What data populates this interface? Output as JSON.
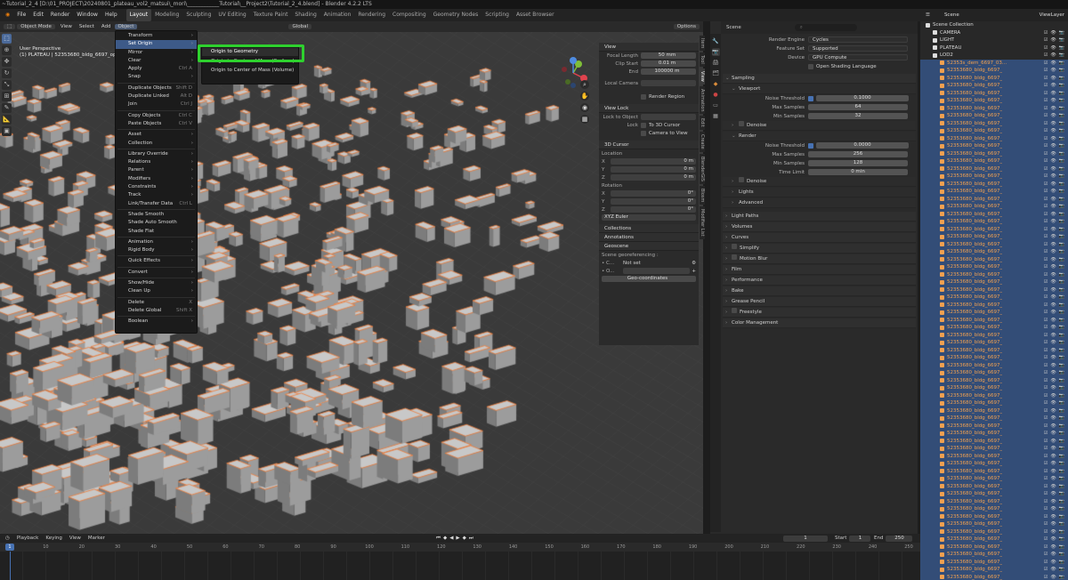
{
  "titlebar": {
    "text": "~Tutorial_2_4 [D:\\01_PROJECT\\20240801_plateau_vol2_matsui\\_mori\\____________Tutorial\\__Project2\\Tutorial_2_4.blend] - Blender 4.2.2 LTS"
  },
  "menubar": {
    "items": [
      "File",
      "Edit",
      "Render",
      "Window",
      "Help"
    ],
    "workspaces": [
      "Layout",
      "Modeling",
      "Sculpting",
      "UV Editing",
      "Texture Paint",
      "Shading",
      "Animation",
      "Rendering",
      "Compositing",
      "Geometry Nodes",
      "Scripting",
      "Asset Browser"
    ],
    "scene_label": "Scene",
    "viewlayer_label": "ViewLayer"
  },
  "viewport": {
    "mode": "Object Mode",
    "menus": [
      "View",
      "Select",
      "Add",
      "Object"
    ],
    "transform": "Global",
    "options": "Options",
    "info_line1": "User Perspective",
    "info_line2": "(1) PLATEAU | 52353680_bldg_6697_op..."
  },
  "object_menu": {
    "items": [
      {
        "label": "Transform",
        "shortcut": "",
        "arrow": true
      },
      {
        "label": "Set Origin",
        "shortcut": "",
        "arrow": true,
        "highlight": true
      },
      {
        "label": "Mirror",
        "shortcut": "",
        "arrow": true
      },
      {
        "label": "Clear",
        "shortcut": "",
        "arrow": true
      },
      {
        "label": "Apply",
        "shortcut": "Ctrl A",
        "arrow": false
      },
      {
        "label": "Snap",
        "shortcut": "",
        "arrow": true
      },
      {
        "sep": true
      },
      {
        "label": "Duplicate Objects",
        "shortcut": "Shift D",
        "arrow": false
      },
      {
        "label": "Duplicate Linked",
        "shortcut": "Alt D",
        "arrow": false
      },
      {
        "label": "Join",
        "shortcut": "Ctrl J",
        "arrow": false
      },
      {
        "sep": true
      },
      {
        "label": "Copy Objects",
        "shortcut": "Ctrl C",
        "arrow": false
      },
      {
        "label": "Paste Objects",
        "shortcut": "Ctrl V",
        "arrow": false
      },
      {
        "sep": true
      },
      {
        "label": "Asset",
        "shortcut": "",
        "arrow": true
      },
      {
        "label": "Collection",
        "shortcut": "",
        "arrow": true
      },
      {
        "sep": true
      },
      {
        "label": "Library Override",
        "shortcut": "",
        "arrow": true
      },
      {
        "label": "Relations",
        "shortcut": "",
        "arrow": true
      },
      {
        "label": "Parent",
        "shortcut": "",
        "arrow": true
      },
      {
        "label": "Modifiers",
        "shortcut": "",
        "arrow": true
      },
      {
        "label": "Constraints",
        "shortcut": "",
        "arrow": true
      },
      {
        "label": "Track",
        "shortcut": "",
        "arrow": true
      },
      {
        "label": "Link/Transfer Data",
        "shortcut": "Ctrl L",
        "arrow": false
      },
      {
        "sep": true
      },
      {
        "label": "Shade Smooth",
        "shortcut": "",
        "arrow": false
      },
      {
        "label": "Shade Auto Smooth",
        "shortcut": "",
        "arrow": false
      },
      {
        "label": "Shade Flat",
        "shortcut": "",
        "arrow": false
      },
      {
        "sep": true
      },
      {
        "label": "Animation",
        "shortcut": "",
        "arrow": true
      },
      {
        "label": "Rigid Body",
        "shortcut": "",
        "arrow": true
      },
      {
        "sep": true
      },
      {
        "label": "Quick Effects",
        "shortcut": "",
        "arrow": true
      },
      {
        "sep": true
      },
      {
        "label": "Convert",
        "shortcut": "",
        "arrow": true
      },
      {
        "sep": true
      },
      {
        "label": "Show/Hide",
        "shortcut": "",
        "arrow": true
      },
      {
        "label": "Clean Up",
        "shortcut": "",
        "arrow": true
      },
      {
        "sep": true
      },
      {
        "label": "Delete",
        "shortcut": "X",
        "arrow": false
      },
      {
        "label": "Delete Global",
        "shortcut": "Shift X",
        "arrow": false
      },
      {
        "sep": true
      },
      {
        "label": "Boolean",
        "shortcut": "",
        "arrow": true
      }
    ]
  },
  "set_origin_menu": {
    "items": [
      "Origin to Geometry",
      "Origin to Center of Mass (Surface)",
      "Origin to Center of Mass (Volume)"
    ],
    "highlighted": "Origin to Geometry"
  },
  "npanel": {
    "view_header": "View",
    "focal_length": {
      "label": "Focal Length",
      "value": "50 mm"
    },
    "clip_start": {
      "label": "Clip Start",
      "value": "0.01 m"
    },
    "clip_end": {
      "label": "End",
      "value": "100000 m"
    },
    "local_camera": "Local Camera",
    "render_region": "Render Region",
    "view_lock_header": "View Lock",
    "lock_to_object": "Lock to Object",
    "lock": "Lock",
    "to_3d_cursor": "To 3D Cursor",
    "camera_to_view": "Camera to View",
    "cursor_header": "3D Cursor",
    "location_label": "Location",
    "rotation_label": "Rotation",
    "loc": [
      {
        "axis": "X",
        "value": "0 m"
      },
      {
        "axis": "Y",
        "value": "0 m"
      },
      {
        "axis": "Z",
        "value": "0 m"
      }
    ],
    "rot": [
      {
        "axis": "X",
        "value": "0°"
      },
      {
        "axis": "Y",
        "value": "0°"
      },
      {
        "axis": "Z",
        "value": "0°"
      }
    ],
    "rotation_mode": "XYZ Euler",
    "collections": "Collections",
    "annotations": "Annotations",
    "geoscene": "Geoscene",
    "geo_label": "Scene georeferencing :",
    "not_set": "Not set",
    "geo_coords": "Geo-coordinates",
    "tabs": [
      "Item",
      "Tool",
      "View",
      "Animation",
      "Edit",
      "Create",
      "BlenderGIS",
      "Blosm",
      "Modifier List"
    ]
  },
  "properties": {
    "scene_label": "Scene",
    "search_placeholder": "",
    "render_engine": {
      "label": "Render Engine",
      "value": "Cycles"
    },
    "feature_set": {
      "label": "Feature Set",
      "value": "Supported"
    },
    "device": {
      "label": "Device",
      "value": "GPU Compute"
    },
    "osl": "Open Shading Language",
    "sampling": "Sampling",
    "viewport": "Viewport",
    "vp_noise": {
      "label": "Noise Threshold",
      "value": "0.1000"
    },
    "vp_max": {
      "label": "Max Samples",
      "value": "64"
    },
    "vp_min": {
      "label": "Min Samples",
      "value": "32"
    },
    "denoise": "Denoise",
    "render": "Render",
    "r_noise": {
      "label": "Noise Threshold",
      "value": "0.0000"
    },
    "r_max": {
      "label": "Max Samples",
      "value": "256"
    },
    "r_min": {
      "label": "Min Samples",
      "value": "128"
    },
    "r_time": {
      "label": "Time Limit",
      "value": "0 min"
    },
    "r_denoise": "Denoise",
    "lights": "Lights",
    "advanced": "Advanced",
    "sections": [
      "Light Paths",
      "Volumes",
      "Curves",
      "Simplify",
      "Motion Blur",
      "Film",
      "Performance",
      "Bake",
      "Grease Pencil",
      "Freestyle",
      "Color Management"
    ]
  },
  "outliner": {
    "scene_collection": "Scene Collection",
    "items": [
      {
        "name": "CAMERA",
        "indent": 1,
        "sel": false,
        "color": "#e06b3a"
      },
      {
        "name": "LIGHT",
        "indent": 1,
        "sel": false,
        "color": "#e06b3a"
      },
      {
        "name": "PLATEAU",
        "indent": 1,
        "sel": false,
        "color": "#e06b3a"
      },
      {
        "name": "LOD2",
        "indent": 1,
        "sel": false,
        "color": "#e06b3a"
      }
    ],
    "prefix": "52353680_bldg_6697_",
    "first": "52353s_dem_6697_03..."
  },
  "timeline": {
    "menus": [
      "Playback",
      "Keying",
      "View",
      "Marker"
    ],
    "current": "1",
    "start_label": "Start",
    "start": "1",
    "end_label": "End",
    "end": "250",
    "ticks": [
      "0",
      "10",
      "20",
      "30",
      "40",
      "50",
      "60",
      "70",
      "80",
      "90",
      "100",
      "110",
      "120",
      "130",
      "140",
      "150",
      "160",
      "170",
      "180",
      "190",
      "200",
      "210",
      "220",
      "230",
      "240",
      "250"
    ],
    "cursor": "1"
  },
  "colors": {
    "accent": "#4772b3",
    "highlight_box": "#2ed12e",
    "selection": "#f07a35"
  }
}
